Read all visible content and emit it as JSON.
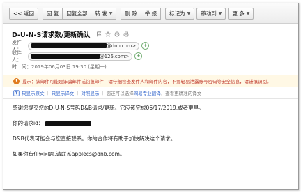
{
  "toolbar": {
    "back": "<< 返回",
    "reply": "回 复",
    "reply_all": "回复全部",
    "forward": "转 发",
    "delete": "删 除",
    "report": "举 报",
    "mark_as": "标记为",
    "move_to": "移动到",
    "more": "更 多"
  },
  "email": {
    "subject": "D-U-N-S请求数/更新确认",
    "from_label": "发件人：",
    "from_domain": "@dnb.com>",
    "to_label": "收件人：",
    "to_domain": "@126.com>",
    "time_label": "时　间：",
    "time_value": "2019年06月03日 19:30 (星期一)"
  },
  "warning": {
    "text": "提示：该邮件可能是诈骗邮件或钓鱼邮件！请仔细检查发件人和邮件内容，不要轻易泄露账号密码等安全信息，请谨慎识别。"
  },
  "display_bar": {
    "plain": "只显示原文",
    "translated": "只显示译文",
    "bilingual": "对照显示",
    "hint": "您还可以选择",
    "youdao": "网易专业翻译",
    "standard": "，查看更精准的译文"
  },
  "body": {
    "line1": "感谢您提交您的D-U-N-S号码D&B请求/更新。它应该完成06/17/2019,或者更早。",
    "line2_prefix": "你的请求id：",
    "line3": "D&B代表可能会与您直接联系。你的合作将有助于加快解决这个请求。",
    "line4": "如果你有任何问题,请联系applecs@dnb.com。"
  },
  "colors": {
    "warning_text": "#c0392b",
    "link": "#3366cc",
    "redaction": "#111111"
  }
}
